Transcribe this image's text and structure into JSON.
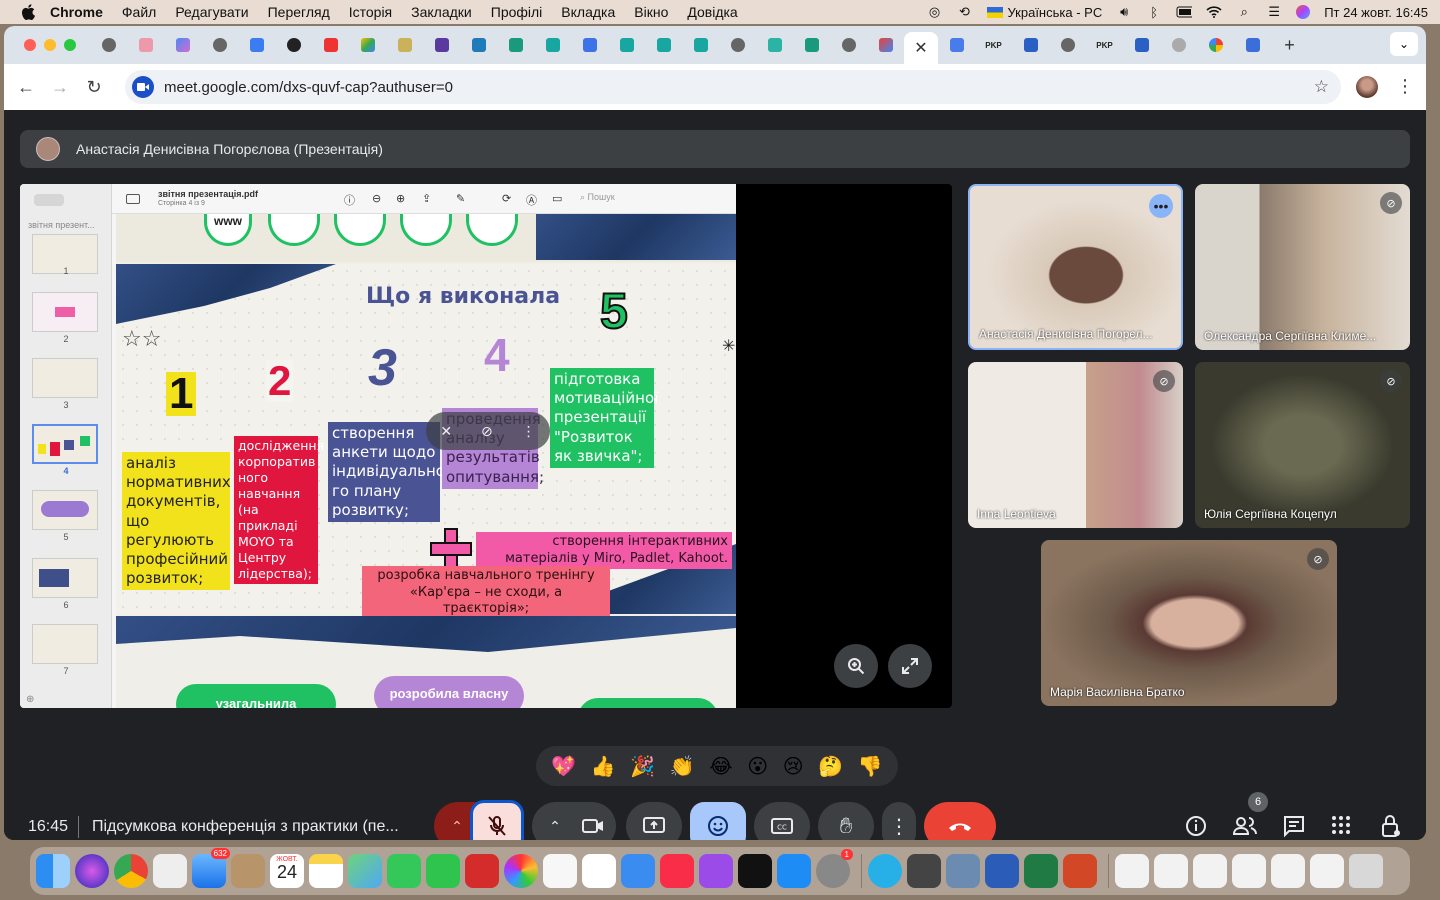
{
  "menubar": {
    "app": "Chrome",
    "items": [
      "Файл",
      "Редагувати",
      "Перегляд",
      "Історія",
      "Закладки",
      "Профілі",
      "Вкладка",
      "Вікно",
      "Довідка"
    ],
    "input_source": "Українська - PC",
    "datetime": "Пт 24 жовт. 16:45"
  },
  "browser": {
    "url": "meet.google.com/dxs-quvf-cap?authuser=0",
    "tab_badge_1": "PKP",
    "tab_badge_2": "PKP"
  },
  "meet": {
    "presenter_banner": "Анастасія Денисівна Погорєлова (Презентація)",
    "time": "16:45",
    "meeting_title": "Підсумкова конференція з практики (пе...",
    "participant_count": "6",
    "reactions": [
      "💖",
      "👍",
      "🎉",
      "👏",
      "😂",
      "😮",
      "😢",
      "🤔",
      "👎"
    ],
    "participants": [
      {
        "name": "Анастасія Денисівна Погорєл..."
      },
      {
        "name": "Олександра Сергіївна Климе..."
      },
      {
        "name": "Inna Leontieva"
      },
      {
        "name": "Юлія Сергіївна Коцепул"
      },
      {
        "name": "Марія Василівна Братко"
      }
    ]
  },
  "pdf": {
    "filename": "звітня презентація.pdf",
    "page_info": "Сторінка 4 із 9",
    "search_placeholder": "Пошук",
    "sidebar_title": "звітня презент...",
    "thumb_numbers": [
      "1",
      "2",
      "3",
      "4",
      "5",
      "6",
      "7"
    ]
  },
  "slide": {
    "title": "Що я виконала",
    "numbers": [
      "1",
      "2",
      "3",
      "4",
      "5"
    ],
    "box1": "аналіз нормативних документів, що регулюють професійний розвиток;",
    "box2": "дослідження корпоратив ного навчання (на прикладі MOYO та Центру лідерства);",
    "box3": "створення анкети щодо індивідуально го плану розвитку;",
    "box4": "проведення аналізу результатів опитування;",
    "box5": "підготовка мотиваційної презентації \"Розвиток як звичка\";",
    "box6": "створення інтерактивних матеріалів у Miro, Padlet, Kahoot.",
    "box7": "розробка навчального тренінгу «Кар'єра – не сходи, а траєкторія»;",
    "next_slide_left": "узагальнила",
    "next_slide_mid": "розробила власну",
    "prev_slide_text": "www"
  },
  "dock": {
    "mail_badge": "632",
    "calendar_month": "ЖОВТ.",
    "calendar_day": "24",
    "settings_badge": "1"
  },
  "colors": {
    "yellow": "#f2e21b",
    "red": "#e0163f",
    "navy": "#4a5394",
    "lilac": "#b585d6",
    "green": "#20c163",
    "pink": "#f25aa8",
    "coral": "#f2657a",
    "end_call": "#ea4335"
  }
}
